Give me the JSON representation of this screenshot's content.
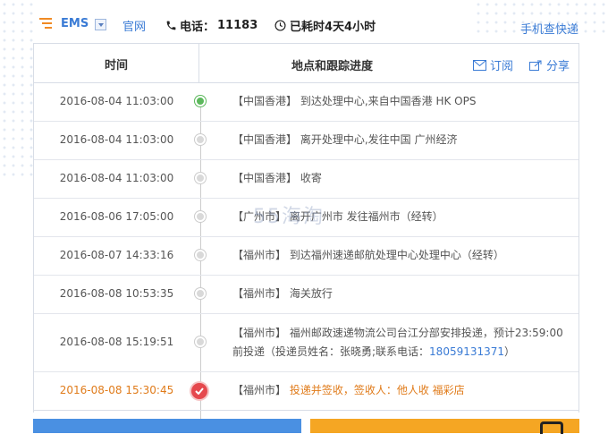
{
  "header": {
    "carrier": "EMS",
    "site_link": "官网",
    "phone_label": "电话：",
    "phone_number": "11183",
    "elapsed": "已耗时4天4小时",
    "mobile_link": "手机查快递"
  },
  "table": {
    "col_time": "时间",
    "col_location": "地点和跟踪进度",
    "subscribe": "订阅",
    "share": "分享"
  },
  "rows": [
    {
      "time": "2016-08-04 11:03:00",
      "loc": "【中国香港】",
      "text": "到达处理中心,来自中国香港 HK OPS"
    },
    {
      "time": "2016-08-04 11:03:00",
      "loc": "【中国香港】",
      "text": "离开处理中心,发往中国 广州经济"
    },
    {
      "time": "2016-08-04 11:03:00",
      "loc": "【中国香港】",
      "text": "收寄"
    },
    {
      "time": "2016-08-06 17:05:00",
      "loc": "【广州市】",
      "text": "离开广州市 发往福州市（经转）"
    },
    {
      "time": "2016-08-07 14:33:16",
      "loc": "【福州市】",
      "text": "到达福州速递邮航处理中心处理中心（经转）"
    },
    {
      "time": "2016-08-08 10:53:35",
      "loc": "【福州市】",
      "text": "海关放行"
    },
    {
      "time": "2016-08-08 15:19:51",
      "loc": "【福州市】",
      "text": "福州邮政速递物流公司台江分部安排投递，预计23:59:00前投递（投递员姓名：张晓勇;联系电话：",
      "phone": "18059131371",
      "tail": "）"
    },
    {
      "time": "2016-08-08 15:30:45",
      "loc": "【福州市】",
      "text": "投递并签收，签收人：他人收 福彩店"
    }
  ],
  "watermark": "55海淘",
  "colors": {
    "link": "#3a7bd5",
    "accent_orange": "#e07b1a",
    "node_green": "#5cb85c",
    "node_red": "#e5484d"
  }
}
